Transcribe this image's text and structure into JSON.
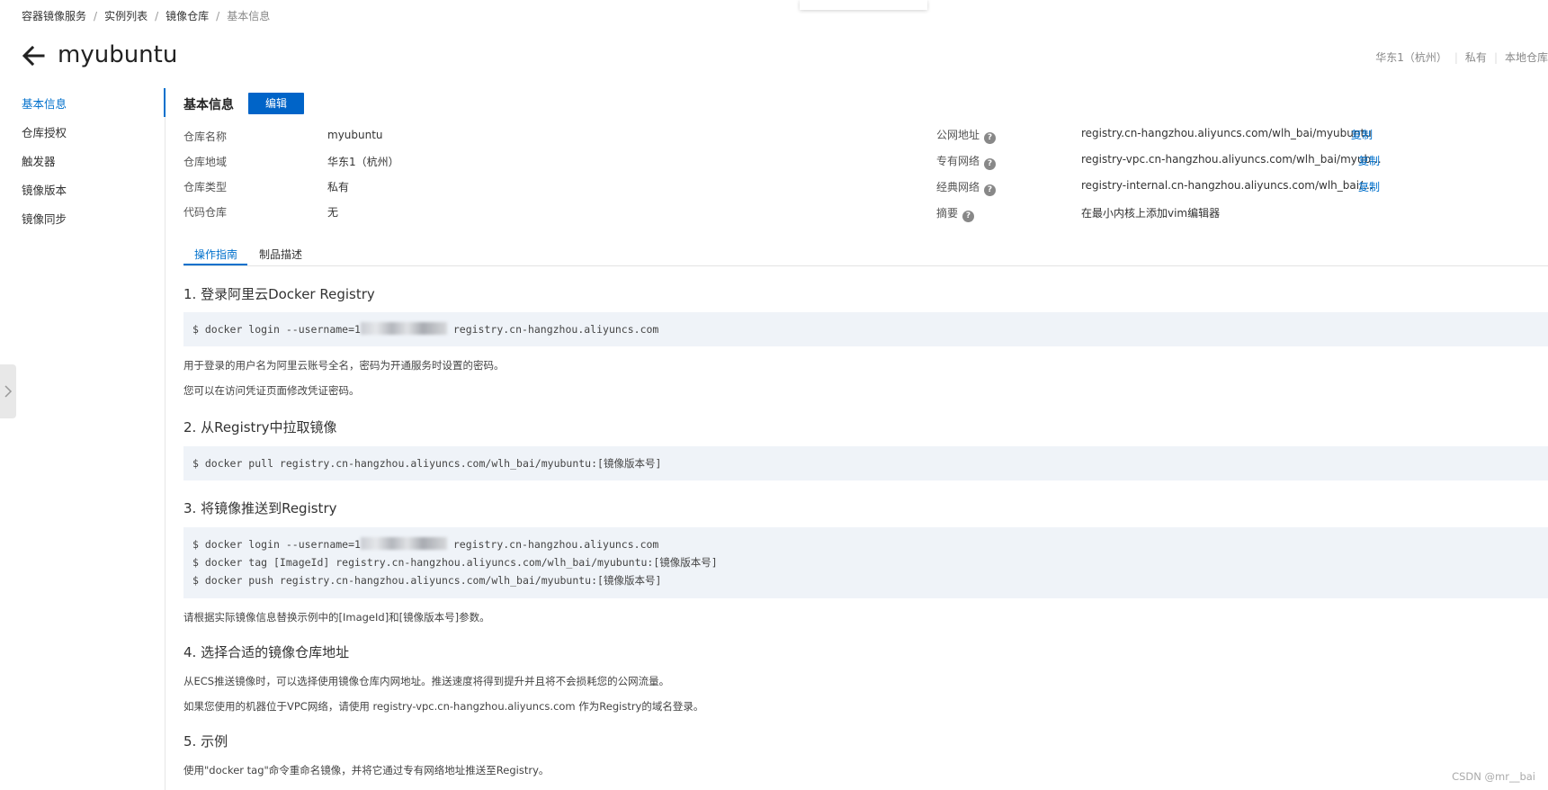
{
  "breadcrumb": {
    "items": [
      "容器镜像服务",
      "实例列表",
      "镜像仓库"
    ],
    "current": "基本信息",
    "separator": "/"
  },
  "header": {
    "title": "myubuntu",
    "meta": [
      "华东1（杭州）",
      "私有",
      "本地仓库"
    ]
  },
  "sidenav": {
    "items": [
      {
        "label": "基本信息",
        "active": true
      },
      {
        "label": "仓库授权"
      },
      {
        "label": "触发器"
      },
      {
        "label": "镜像版本"
      },
      {
        "label": "镜像同步"
      }
    ]
  },
  "basic_info": {
    "title": "基本信息",
    "edit_label": "编辑",
    "left": [
      {
        "label": "仓库名称",
        "value": "myubuntu"
      },
      {
        "label": "仓库地域",
        "value": "华东1（杭州）"
      },
      {
        "label": "仓库类型",
        "value": "私有"
      },
      {
        "label": "代码仓库",
        "value": "无"
      }
    ],
    "right": [
      {
        "label": "公网地址",
        "value": "registry.cn-hangzhou.aliyuncs.com/wlh_bai/myubuntu",
        "copy": "复制"
      },
      {
        "label": "专有网络",
        "value": "registry-vpc.cn-hangzhou.aliyuncs.com/wlh_bai/myub...",
        "copy": "复制"
      },
      {
        "label": "经典网络",
        "value": "registry-internal.cn-hangzhou.aliyuncs.com/wlh_bai/...",
        "copy": "复制"
      },
      {
        "label": "摘要",
        "value": "在最小内核上添加vim编辑器"
      }
    ]
  },
  "tabs": [
    {
      "label": "操作指南",
      "active": true
    },
    {
      "label": "制品描述"
    }
  ],
  "guide": {
    "step1": {
      "title": "1. 登录阿里云Docker Registry",
      "code_prefix": "$ docker login --username=1",
      "code_suffix": " registry.cn-hangzhou.aliyuncs.com",
      "note1": "用于登录的用户名为阿里云账号全名，密码为开通服务时设置的密码。",
      "note2": "您可以在访问凭证页面修改凭证密码。"
    },
    "step2": {
      "title": "2. 从Registry中拉取镜像",
      "code": "$ docker pull registry.cn-hangzhou.aliyuncs.com/wlh_bai/myubuntu:[镜像版本号]"
    },
    "step3": {
      "title": "3. 将镜像推送到Registry",
      "code1_prefix": "$ docker login --username=1",
      "code1_suffix": " registry.cn-hangzhou.aliyuncs.com",
      "code2": "$ docker tag [ImageId] registry.cn-hangzhou.aliyuncs.com/wlh_bai/myubuntu:[镜像版本号]",
      "code3": "$ docker push registry.cn-hangzhou.aliyuncs.com/wlh_bai/myubuntu:[镜像版本号]",
      "note": "请根据实际镜像信息替换示例中的[ImageId]和[镜像版本号]参数。"
    },
    "step4": {
      "title": "4. 选择合适的镜像仓库地址",
      "note1": "从ECS推送镜像时，可以选择使用镜像仓库内网地址。推送速度将得到提升并且将不会损耗您的公网流量。",
      "note2": "如果您使用的机器位于VPC网络，请使用 registry-vpc.cn-hangzhou.aliyuncs.com 作为Registry的域名登录。"
    },
    "step5": {
      "title": "5. 示例",
      "note": "使用\"docker tag\"命令重命名镜像，并将它通过专有网络地址推送至Registry。"
    }
  },
  "watermark": "CSDN @mr__bai",
  "colors": {
    "accent": "#0070cc",
    "button": "#0064c8",
    "code_bg": "#eff3f8"
  }
}
